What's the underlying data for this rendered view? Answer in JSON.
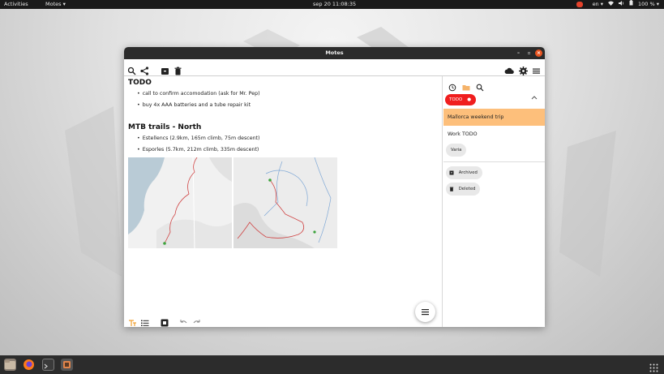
{
  "topbar": {
    "activities": "Activities",
    "app_menu": "Motes ▾",
    "clock": "sep 20  11:08:35",
    "notif_badge": "",
    "language": "en ▾",
    "battery": "100 % ▾"
  },
  "window": {
    "title": "Motes",
    "min_glyph": "–",
    "max_glyph": "▫",
    "close_glyph": "×"
  },
  "toolbar": {
    "icons": [
      "search-icon",
      "share-icon",
      "archive-icon",
      "delete-icon",
      "cloud-icon",
      "gear-icon",
      "menu-icon"
    ]
  },
  "note": {
    "sections": [
      {
        "heading": "TODO",
        "items": [
          "call to confirm accomodation (ask for Mr. Pep)",
          "buy 4x AAA batteries and a tube repair kit"
        ]
      },
      {
        "heading": "MTB trails - North",
        "items": [
          "Estellencs (2.9km, 165m climb, 75m descent)",
          "Esporles (5.7km, 212m climb, 335m descent)"
        ]
      }
    ]
  },
  "sidebar": {
    "icons": [
      "history-icon",
      "folder-icon",
      "search-icon"
    ],
    "tag_label": "TODO",
    "notes": [
      {
        "title": "Mallorca weekend trip",
        "selected": true
      },
      {
        "title": "Work TODO",
        "selected": false
      }
    ],
    "chips": {
      "varia": "Varia",
      "archived": "Archived",
      "deleted": "Deleted"
    }
  },
  "colors": {
    "accent_orange": "#fdbf7b",
    "tag_red": "#f01e1e",
    "close_button": "#e95420"
  }
}
